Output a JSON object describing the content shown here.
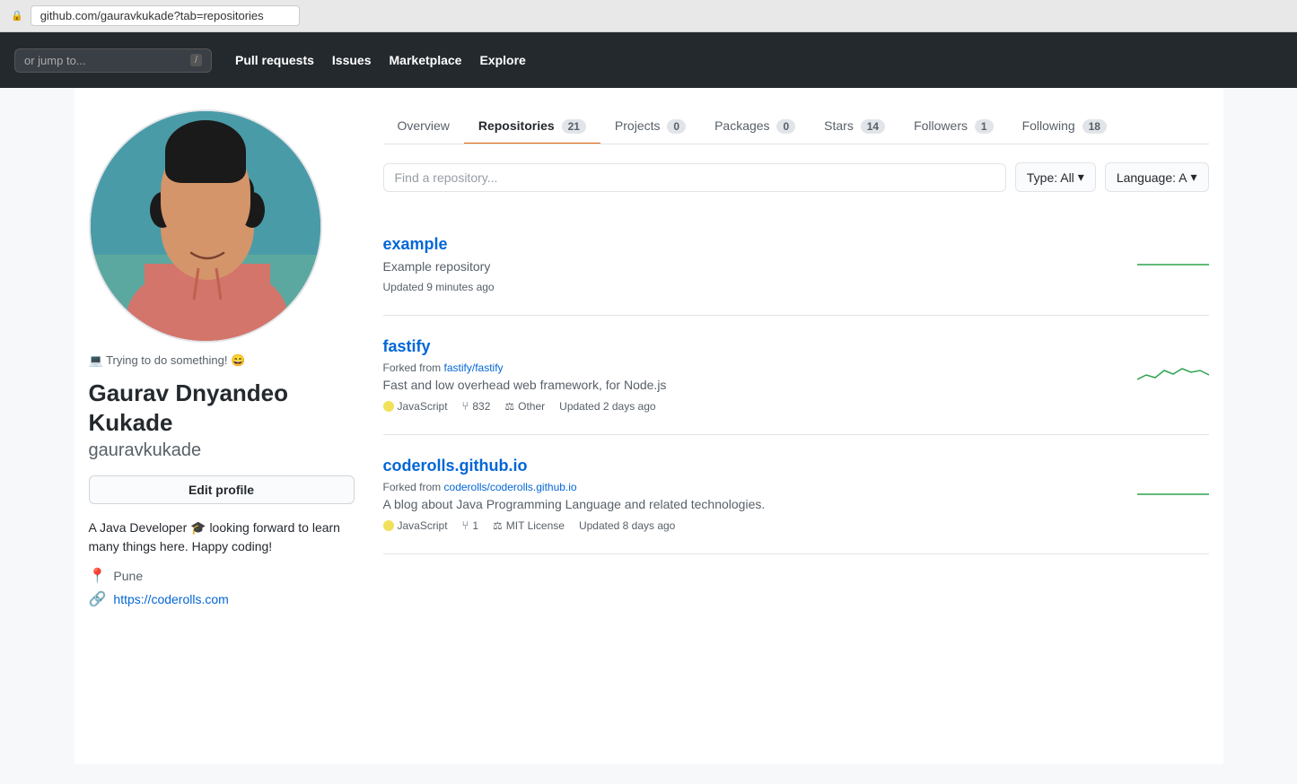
{
  "browser": {
    "url": "github.com/gauravkukade?tab=repositories",
    "lock_icon": "🔒"
  },
  "nav": {
    "search_placeholder": "or jump to...",
    "search_kbd": "/",
    "links": [
      {
        "label": "Pull requests",
        "id": "pull-requests"
      },
      {
        "label": "Issues",
        "id": "issues"
      },
      {
        "label": "Marketplace",
        "id": "marketplace"
      },
      {
        "label": "Explore",
        "id": "explore"
      }
    ]
  },
  "profile": {
    "avatar_emoji": "👤",
    "status": "💻 Trying to do something! 😄",
    "full_name": "Gaurav Dnyandeo Kukade",
    "handle": "gauravkukade",
    "edit_label": "Edit profile",
    "bio": "A Java Developer 🎓 looking forward to learn many things here. Happy coding!",
    "location": "Pune",
    "website": "https://coderolls.com",
    "location_icon": "📍",
    "website_icon": "🔗"
  },
  "tabs": [
    {
      "label": "Overview",
      "count": null,
      "id": "overview",
      "active": false
    },
    {
      "label": "Repositories",
      "count": "21",
      "id": "repositories",
      "active": true
    },
    {
      "label": "Projects",
      "count": "0",
      "id": "projects",
      "active": false
    },
    {
      "label": "Packages",
      "count": "0",
      "id": "packages",
      "active": false
    },
    {
      "label": "Stars",
      "count": "14",
      "id": "stars",
      "active": false
    },
    {
      "label": "Followers",
      "count": "1",
      "id": "followers",
      "active": false
    },
    {
      "label": "Following",
      "count": "18",
      "id": "following",
      "active": false
    }
  ],
  "search": {
    "placeholder": "Find a repository...",
    "type_label": "Type: All",
    "language_label": "Language: A"
  },
  "repos": [
    {
      "name": "example",
      "fork": false,
      "fork_source": "",
      "description": "Example repository",
      "language": null,
      "lang_color": null,
      "forks": null,
      "license": null,
      "updated": "Updated 9 minutes ago",
      "has_sparkline": true,
      "sparkline_color": "#2ea44f"
    },
    {
      "name": "fastify",
      "fork": true,
      "fork_source": "fastify/fastify",
      "description": "Fast and low overhead web framework, for Node.js",
      "language": "JavaScript",
      "lang_color": "#f1e05a",
      "forks": "832",
      "license": "Other",
      "updated": "Updated 2 days ago",
      "has_sparkline": true,
      "sparkline_color": "#2ea44f"
    },
    {
      "name": "coderolls.github.io",
      "fork": true,
      "fork_source": "coderolls/coderolls.github.io",
      "description": "A blog about Java Programming Language and related technologies.",
      "language": "JavaScript",
      "lang_color": "#f1e05a",
      "forks": "1",
      "license": "MIT License",
      "updated": "Updated 8 days ago",
      "has_sparkline": true,
      "sparkline_color": "#2ea44f"
    }
  ],
  "icons": {
    "fork": "⑂",
    "location": "📍",
    "link": "🔗",
    "lock": "🔒",
    "scale": "⚖"
  }
}
